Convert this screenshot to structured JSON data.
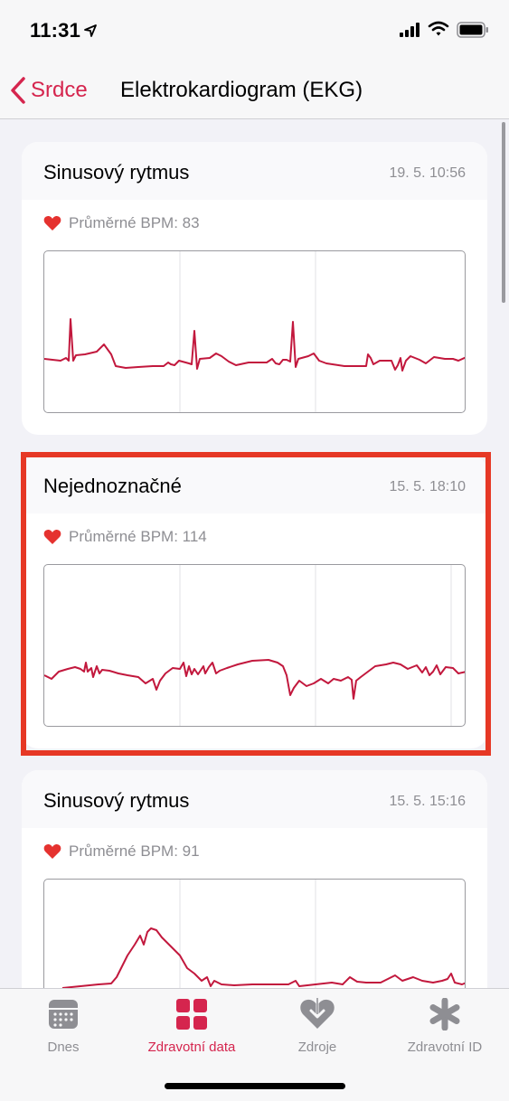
{
  "status_bar": {
    "time": "11:31",
    "icons": [
      "location-arrow-icon",
      "signal-icon",
      "wifi-icon",
      "battery-icon"
    ]
  },
  "nav": {
    "back_label": "Srdce",
    "title": "Elektrokardiogram (EKG)"
  },
  "recordings": [
    {
      "title": "Sinusový rytmus",
      "date": "19. 5. 10:56",
      "bpm_label": "Průměrné BPM: 83"
    },
    {
      "title": "Nejednoznačné",
      "date": "15. 5. 18:10",
      "bpm_label": "Průměrné BPM: 114"
    },
    {
      "title": "Sinusový rytmus",
      "date": "15. 5. 15:16",
      "bpm_label": "Průměrné BPM: 91"
    }
  ],
  "tabs": [
    {
      "label": "Dnes",
      "icon": "calendar-icon",
      "active": false
    },
    {
      "label": "Zdravotní data",
      "icon": "grid-icon",
      "active": true
    },
    {
      "label": "Zdroje",
      "icon": "heart-download-icon",
      "active": false
    },
    {
      "label": "Zdravotní ID",
      "icon": "asterisk-icon",
      "active": false
    }
  ],
  "colors": {
    "accent": "#d5254e",
    "ekg_line": "#c2183d",
    "highlight": "#e63825"
  }
}
